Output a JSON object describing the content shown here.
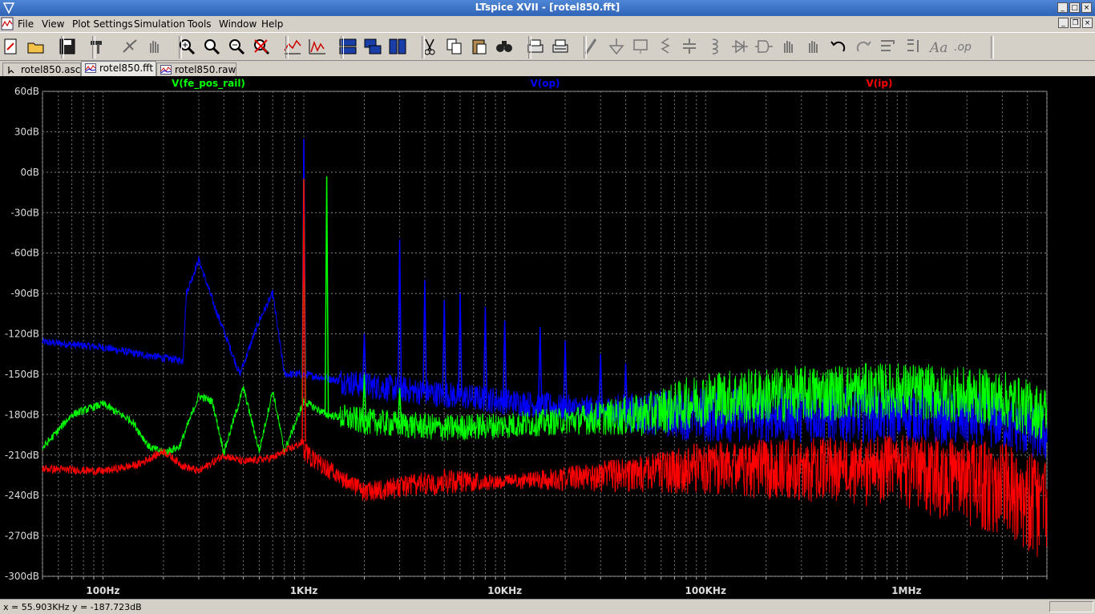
{
  "window": {
    "title": "LTspice XVII - [rotel850.fft]"
  },
  "menu": [
    "File",
    "View",
    "Plot Settings",
    "Simulation",
    "Tools",
    "Window",
    "Help"
  ],
  "toolbar": [
    "new-schematic-icon",
    "open-icon",
    "save-icon",
    "control-panel-hammer-icon",
    "run-icon",
    "halt-hand-icon",
    "zoom-in-icon",
    "zoom-back-icon",
    "zoom-out-icon",
    "zoom-cancel-icon",
    "autorange-icon",
    "fft-icon",
    "tile-horizontal-icon",
    "cascade-icon",
    "tile-vertical-icon",
    "cut-icon",
    "copy-icon",
    "paste-icon",
    "find-icon",
    "print-icon",
    "print-setup-icon",
    "wire-icon",
    "ground-icon",
    "label-net-icon",
    "resistor-icon",
    "capacitor-icon",
    "inductor-icon",
    "diode-icon",
    "component-icon",
    "move-hand-icon",
    "drag-hand-icon",
    "undo-icon",
    "redo-icon",
    "rotate-icon",
    "mirror-icon",
    "text-icon",
    "spice-directive-icon"
  ],
  "tabs": [
    {
      "label": "rotel850.asc",
      "icon": "schematic-icon",
      "active": false
    },
    {
      "label": "rotel850.fft",
      "icon": "waveform-icon",
      "active": true
    },
    {
      "label": "rotel850.raw",
      "icon": "waveform-icon",
      "active": false
    }
  ],
  "status": {
    "coords": "x = 55.903KHz   y = -187.723dB"
  },
  "chart_data": {
    "type": "line",
    "title": "",
    "xscale": "log",
    "xlim": [
      50,
      5000000
    ],
    "ylim": [
      -300,
      60
    ],
    "y_ticks": [
      "60dB",
      "30dB",
      "0dB",
      "-30dB",
      "-60dB",
      "-90dB",
      "-120dB",
      "-150dB",
      "-180dB",
      "-210dB",
      "-240dB",
      "-270dB",
      "-300dB"
    ],
    "x_ticks": [
      {
        "label": "100Hz",
        "value": 100
      },
      {
        "label": "1KHz",
        "value": 1000
      },
      {
        "label": "10KHz",
        "value": 10000
      },
      {
        "label": "100KHz",
        "value": 100000
      },
      {
        "label": "1MHz",
        "value": 1000000
      }
    ],
    "grid": true,
    "series": [
      {
        "name": "V(fe_pos_rail)",
        "color": "#00ff00",
        "envelope": [
          [
            50,
            -205
          ],
          [
            70,
            -180
          ],
          [
            100,
            -172
          ],
          [
            140,
            -185
          ],
          [
            170,
            -204
          ],
          [
            200,
            -208
          ],
          [
            240,
            -204
          ],
          [
            300,
            -166
          ],
          [
            350,
            -170
          ],
          [
            400,
            -208
          ],
          [
            500,
            -160
          ],
          [
            600,
            -207
          ],
          [
            700,
            -162
          ],
          [
            800,
            -207
          ],
          [
            1000,
            -170
          ],
          [
            1300,
            -180
          ],
          [
            2000,
            -185
          ],
          [
            5000,
            -190
          ],
          [
            10000,
            -188
          ],
          [
            50000,
            -180
          ],
          [
            100000,
            -168
          ],
          [
            500000,
            -163
          ],
          [
            1000000,
            -162
          ],
          [
            3000000,
            -168
          ],
          [
            5000000,
            -180
          ]
        ],
        "peaks": [
          [
            1000,
            -5
          ],
          [
            1300,
            -3
          ],
          [
            2000,
            -150
          ],
          [
            3000,
            -160
          ]
        ]
      },
      {
        "name": "V(op)",
        "color": "#0000ff",
        "envelope": [
          [
            50,
            -126
          ],
          [
            100,
            -130
          ],
          [
            150,
            -135
          ],
          [
            250,
            -140
          ],
          [
            260,
            -90
          ],
          [
            300,
            -65
          ],
          [
            360,
            -100
          ],
          [
            400,
            -118
          ],
          [
            480,
            -150
          ],
          [
            600,
            -110
          ],
          [
            700,
            -90
          ],
          [
            800,
            -150
          ],
          [
            1000,
            -150
          ],
          [
            2000,
            -158
          ],
          [
            5000,
            -165
          ],
          [
            10000,
            -170
          ],
          [
            30000,
            -178
          ],
          [
            100000,
            -180
          ],
          [
            1000000,
            -180
          ],
          [
            3000000,
            -185
          ],
          [
            5000000,
            -195
          ]
        ],
        "peaks": [
          [
            1000,
            25
          ],
          [
            2000,
            -120
          ],
          [
            3000,
            -50
          ],
          [
            4000,
            -80
          ],
          [
            5000,
            -95
          ],
          [
            6000,
            -90
          ],
          [
            8000,
            -100
          ],
          [
            10000,
            -110
          ],
          [
            15000,
            -115
          ],
          [
            20000,
            -125
          ],
          [
            30000,
            -135
          ],
          [
            40000,
            -142
          ]
        ]
      },
      {
        "name": "V(ip)",
        "color": "#ff0000",
        "envelope": [
          [
            50,
            -220
          ],
          [
            100,
            -222
          ],
          [
            150,
            -217
          ],
          [
            200,
            -207
          ],
          [
            250,
            -218
          ],
          [
            300,
            -222
          ],
          [
            400,
            -210
          ],
          [
            500,
            -215
          ],
          [
            700,
            -212
          ],
          [
            1000,
            -200
          ],
          [
            1500,
            -220
          ],
          [
            2000,
            -230
          ],
          [
            5000,
            -220
          ],
          [
            10000,
            -225
          ],
          [
            50000,
            -210
          ],
          [
            100000,
            -200
          ],
          [
            1000000,
            -195
          ],
          [
            3000000,
            -200
          ],
          [
            5000000,
            -210
          ]
        ],
        "lower": [
          [
            1000,
            -215
          ],
          [
            2000,
            -245
          ],
          [
            10000,
            -235
          ],
          [
            100000,
            -240
          ],
          [
            1000000,
            -250
          ],
          [
            3000000,
            -270
          ],
          [
            5000000,
            -290
          ]
        ],
        "peaks": [
          [
            1000,
            -5
          ]
        ]
      }
    ]
  }
}
